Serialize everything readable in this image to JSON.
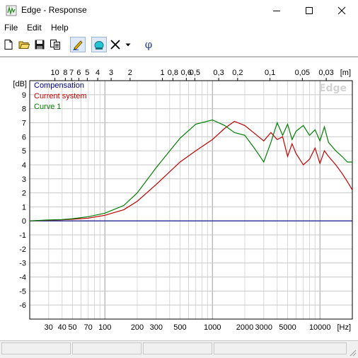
{
  "window": {
    "title": "Edge - Response"
  },
  "menu": [
    {
      "label": "File"
    },
    {
      "label": "Edit"
    },
    {
      "label": "Help"
    }
  ],
  "toolbar": {
    "icons": [
      "new-file-icon",
      "open-folder-icon",
      "save-icon",
      "copy-icon",
      "pen-icon",
      "cyan-object-icon",
      "close-x-icon",
      "dropdown-arrow-icon",
      "phi-icon"
    ],
    "phi_label": "φ"
  },
  "chart_data": {
    "type": "line",
    "watermark": "Edge",
    "ylabel": "[dB]",
    "xlabel": "[Hz]",
    "top_axis_label": "[m]",
    "ylim": [
      -7,
      10
    ],
    "xlim": [
      20,
      20000
    ],
    "x_log": true,
    "grid": true,
    "yticks": [
      9,
      8,
      7,
      6,
      5,
      4,
      3,
      2,
      1,
      0,
      -1,
      -2,
      -3,
      -4,
      -5,
      -6
    ],
    "xticks": [
      30,
      40,
      50,
      70,
      100,
      200,
      300,
      500,
      1000,
      2000,
      3000,
      5000,
      10000
    ],
    "top_ticks": [
      "10",
      "8",
      "7",
      "6",
      "5",
      "4",
      "3",
      "2",
      "1",
      "0,8",
      "0,6",
      "0,5",
      "0,3",
      "0,2",
      "0,1",
      "0,05",
      "0,03"
    ],
    "top_tick_values_m": [
      10,
      8,
      7,
      6,
      5,
      4,
      3,
      2,
      1,
      0.8,
      0.6,
      0.5,
      0.3,
      0.2,
      0.1,
      0.05,
      0.03
    ],
    "legend_position": "top-left",
    "series": [
      {
        "name": "Compensation",
        "color": "#00007f",
        "x": [
          20,
          20000
        ],
        "y": [
          0,
          0
        ]
      },
      {
        "name": "Current system",
        "color": "#c00000",
        "x": [
          20,
          30,
          40,
          50,
          70,
          100,
          150,
          200,
          300,
          500,
          700,
          1000,
          1300,
          1600,
          2000,
          2500,
          3000,
          3500,
          4000,
          4500,
          5000,
          5500,
          6000,
          7000,
          8000,
          9000,
          10000,
          11000,
          12000,
          14000,
          16000,
          18000,
          20000
        ],
        "y": [
          0,
          0.05,
          0.08,
          0.12,
          0.2,
          0.4,
          0.8,
          1.4,
          2.6,
          4.2,
          5.0,
          5.8,
          6.6,
          7.1,
          6.8,
          6.2,
          5.7,
          6.3,
          5.8,
          6.0,
          4.6,
          5.5,
          4.8,
          4.0,
          4.4,
          5.2,
          4.1,
          5.0,
          4.6,
          4.0,
          3.4,
          2.8,
          2.2
        ]
      },
      {
        "name": "Curve 1",
        "color": "#007f00",
        "x": [
          20,
          30,
          40,
          50,
          70,
          100,
          150,
          200,
          300,
          500,
          700,
          1000,
          1300,
          1600,
          2000,
          2500,
          3000,
          3500,
          4000,
          4500,
          5000,
          5500,
          6000,
          7000,
          8000,
          9000,
          10000,
          11000,
          12000,
          14000,
          16000,
          18000,
          20000
        ],
        "y": [
          0,
          0.07,
          0.1,
          0.16,
          0.3,
          0.55,
          1.1,
          2.0,
          3.8,
          5.9,
          6.9,
          7.2,
          6.8,
          6.3,
          6.1,
          5.1,
          4.2,
          5.6,
          7.0,
          6.1,
          6.9,
          5.8,
          6.4,
          6.8,
          6.1,
          6.5,
          5.7,
          6.7,
          5.6,
          5.0,
          4.6,
          4.2,
          4.2
        ]
      }
    ]
  }
}
